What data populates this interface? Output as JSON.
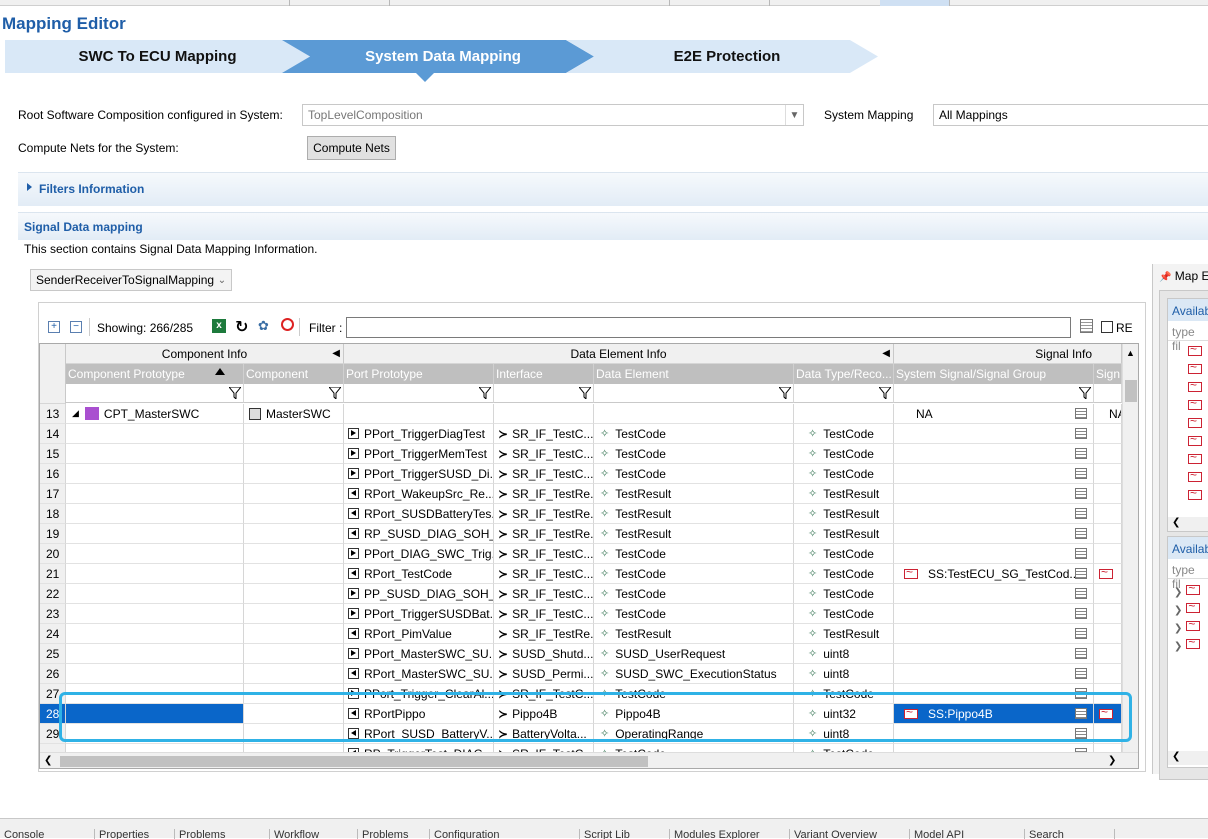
{
  "editor_title": "Mapping Editor",
  "tabs": [
    {
      "label": "SWC To ECU Mapping",
      "active": false
    },
    {
      "label": "System Data Mapping",
      "active": true
    },
    {
      "label": "E2E Protection",
      "active": false
    }
  ],
  "root_composition": {
    "label": "Root Software Composition configured in System:",
    "value": "TopLevelComposition"
  },
  "system_mapping": {
    "label": "System Mapping",
    "value": "All Mappings"
  },
  "compute_nets": {
    "label": "Compute Nets for the System:",
    "button": "Compute Nets"
  },
  "filters_section": {
    "title": "Filters Information"
  },
  "signal_section": {
    "title": "Signal Data mapping",
    "description": "This section contains Signal Data Mapping Information."
  },
  "mapping_type": {
    "value": "SenderReceiverToSignalMapping"
  },
  "toolbar": {
    "showing": "Showing: 266/285",
    "filter_label": "Filter :",
    "re_label": "RE"
  },
  "table": {
    "groups": [
      "Component Info",
      "Data Element Info",
      "Signal Info"
    ],
    "columns": [
      "Component Prototype",
      "Component",
      "Port Prototype",
      "Interface",
      "Data Element",
      "Data Type/Reco...",
      "System Signal/Signal Group",
      "Sign"
    ],
    "rows": [
      {
        "n": "13",
        "cp": "CPT_MasterSWC",
        "comp": "MasterSWC",
        "port": "",
        "pdir": "",
        "iface": "",
        "de": "",
        "dt": "",
        "sig": "NA",
        "sig2": "NA",
        "root": true
      },
      {
        "n": "14",
        "cp": "",
        "comp": "",
        "port": "PPort_TriggerDiagTest",
        "pdir": "p",
        "iface": "SR_IF_TestC...",
        "de": "TestCode",
        "dt": "TestCode",
        "sig": "",
        "sig2": ""
      },
      {
        "n": "15",
        "cp": "",
        "comp": "",
        "port": "PPort_TriggerMemTest",
        "pdir": "p",
        "iface": "SR_IF_TestC...",
        "de": "TestCode",
        "dt": "TestCode",
        "sig": "",
        "sig2": ""
      },
      {
        "n": "16",
        "cp": "",
        "comp": "",
        "port": "PPort_TriggerSUSD_Di...",
        "pdir": "p",
        "iface": "SR_IF_TestC...",
        "de": "TestCode",
        "dt": "TestCode",
        "sig": "",
        "sig2": ""
      },
      {
        "n": "17",
        "cp": "",
        "comp": "",
        "port": "RPort_WakeupSrc_Re...",
        "pdir": "r",
        "iface": "SR_IF_TestRe...",
        "de": "TestResult",
        "dt": "TestResult",
        "sig": "",
        "sig2": ""
      },
      {
        "n": "18",
        "cp": "",
        "comp": "",
        "port": "RPort_SUSDBatteryTes...",
        "pdir": "r",
        "iface": "SR_IF_TestRe...",
        "de": "TestResult",
        "dt": "TestResult",
        "sig": "",
        "sig2": ""
      },
      {
        "n": "19",
        "cp": "",
        "comp": "",
        "port": "RP_SUSD_DIAG_SOH_...",
        "pdir": "r",
        "iface": "SR_IF_TestRe...",
        "de": "TestResult",
        "dt": "TestResult",
        "sig": "",
        "sig2": ""
      },
      {
        "n": "20",
        "cp": "",
        "comp": "",
        "port": "PPort_DIAG_SWC_Trig...",
        "pdir": "p",
        "iface": "SR_IF_TestC...",
        "de": "TestCode",
        "dt": "TestCode",
        "sig": "",
        "sig2": ""
      },
      {
        "n": "21",
        "cp": "",
        "comp": "",
        "port": "RPort_TestCode",
        "pdir": "r",
        "iface": "SR_IF_TestC...",
        "de": "TestCode",
        "dt": "TestCode",
        "sig": "SS:TestECU_SG_TestCod...",
        "sig2": "",
        "sigicon": true
      },
      {
        "n": "22",
        "cp": "",
        "comp": "",
        "port": "PP_SUSD_DIAG_SOH_...",
        "pdir": "p",
        "iface": "SR_IF_TestC...",
        "de": "TestCode",
        "dt": "TestCode",
        "sig": "",
        "sig2": ""
      },
      {
        "n": "23",
        "cp": "",
        "comp": "",
        "port": "PPort_TriggerSUSDBat...",
        "pdir": "p",
        "iface": "SR_IF_TestC...",
        "de": "TestCode",
        "dt": "TestCode",
        "sig": "",
        "sig2": ""
      },
      {
        "n": "24",
        "cp": "",
        "comp": "",
        "port": "RPort_PimValue",
        "pdir": "r",
        "iface": "SR_IF_TestRe...",
        "de": "TestResult",
        "dt": "TestResult",
        "sig": "",
        "sig2": ""
      },
      {
        "n": "25",
        "cp": "",
        "comp": "",
        "port": "PPort_MasterSWC_SU...",
        "pdir": "p",
        "iface": "SUSD_Shutd...",
        "de": "SUSD_UserRequest",
        "dt": "uint8",
        "sig": "",
        "sig2": ""
      },
      {
        "n": "26",
        "cp": "",
        "comp": "",
        "port": "RPort_MasterSWC_SU...",
        "pdir": "r",
        "iface": "SUSD_Permi...",
        "de": "SUSD_SWC_ExecutionStatus",
        "dt": "uint8",
        "sig": "",
        "sig2": ""
      },
      {
        "n": "27",
        "cp": "",
        "comp": "",
        "port": "PPort_Trigger_ClearAl...",
        "pdir": "p",
        "iface": "SR_IF_TestC...",
        "de": "TestCode",
        "dt": "TestCode",
        "sig": "",
        "sig2": ""
      },
      {
        "n": "28",
        "cp": "",
        "comp": "",
        "port": "RPortPippo",
        "pdir": "r",
        "iface": "Pippo4B",
        "de": "Pippo4B",
        "dt": "uint32",
        "sig": "SS:Pippo4B",
        "sig2": "",
        "sigicon": true,
        "selected": true
      },
      {
        "n": "29",
        "cp": "",
        "comp": "",
        "port": "RPort_SUSD_BatteryV...",
        "pdir": "r",
        "iface": "BatteryVolta...",
        "de": "OperatingRange",
        "dt": "uint8",
        "sig": "",
        "sig2": ""
      },
      {
        "n": "",
        "cp": "",
        "comp": "",
        "port": "RP_TriggerTest_DIAG...",
        "pdir": "r",
        "iface": "SR_IF_TestC...",
        "de": "TestCode",
        "dt": "TestCode",
        "sig": "",
        "sig2": "",
        "partial": true
      }
    ]
  },
  "right_panel": {
    "title": "Map E",
    "label1": "Availab",
    "filter1": "type fil",
    "label2": "Availab",
    "filter2": "type fil"
  },
  "bottom_tabs": [
    "Console",
    "Properties",
    "Problems",
    "Workflow",
    "Problems",
    "Configuration",
    "Script Lib",
    "Modules Explorer",
    "Variant Overview",
    "Model API",
    "Search"
  ],
  "colors": {
    "title": "#1f5ea8",
    "tab_active": "#5b9ad5",
    "tab_inactive": "#d9e8f7",
    "selection": "#0a66c9",
    "highlight": "#2fb2e6"
  }
}
